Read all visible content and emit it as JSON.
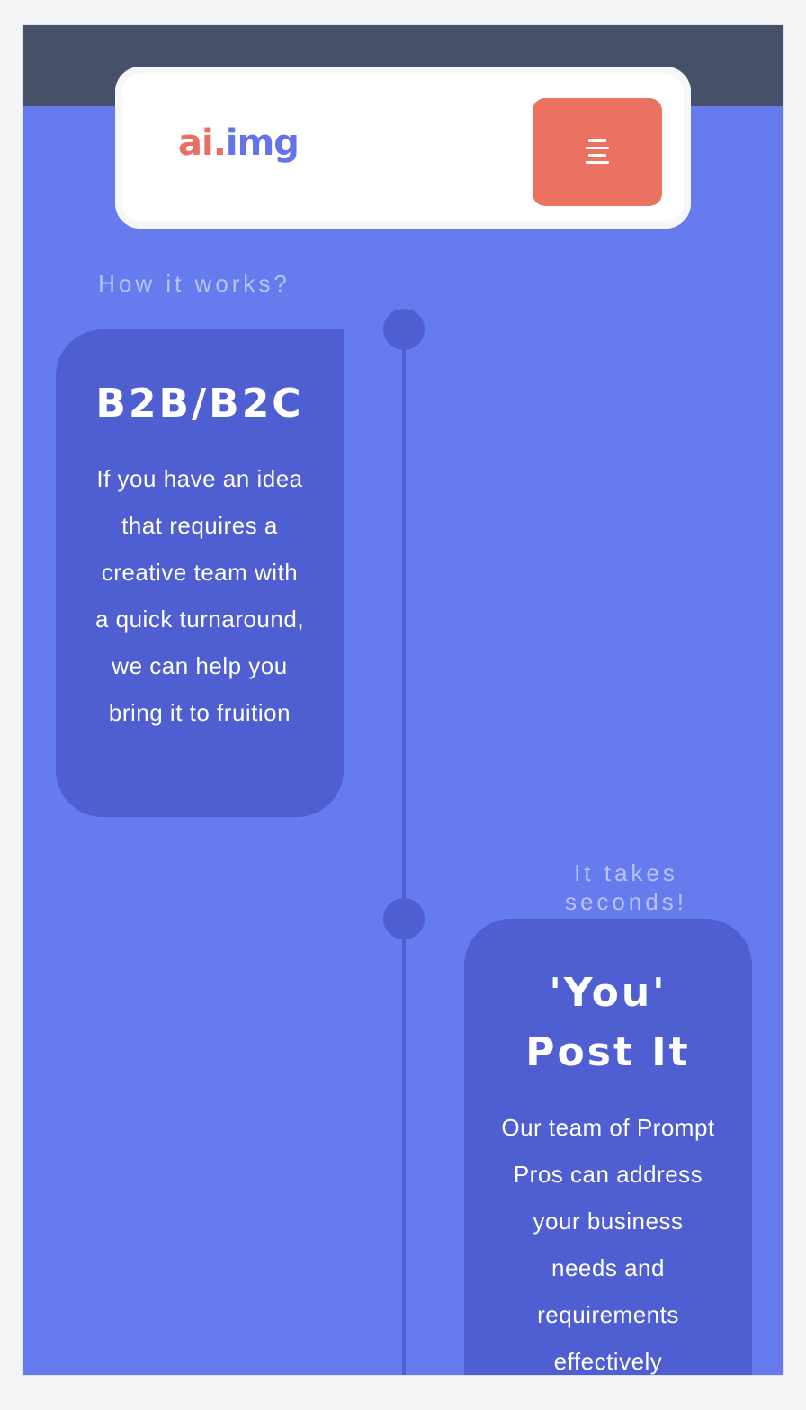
{
  "header": {
    "logo_part1": "ai.",
    "logo_part2": "img",
    "menu_icon": "hamburger-menu-icon"
  },
  "timeline": [
    {
      "eyebrow": "How it works?",
      "title": "B2B/B2C",
      "text": "If you have an idea that requires a creative team with a quick turnaround, we can help you bring it to fruition"
    },
    {
      "eyebrow": "It takes seconds!",
      "title": "'You' Post It",
      "text": "Our team of Prompt Pros can address your business needs and requirements effectively"
    }
  ],
  "colors": {
    "background": "#667bee",
    "topbar": "#465169",
    "card": "#4f5ed1",
    "accent": "#eb7161",
    "logo_red": "#ea6f63",
    "logo_blue": "#6374e8"
  }
}
